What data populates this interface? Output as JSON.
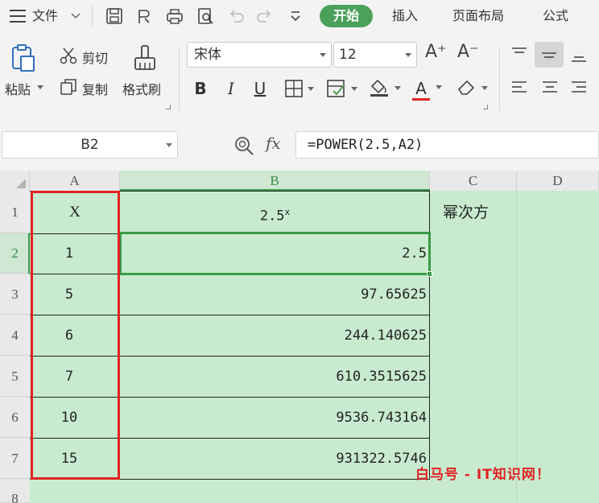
{
  "menu": {
    "file_label": "文件",
    "tabs": [
      {
        "label": "开始",
        "active": true
      },
      {
        "label": "插入"
      },
      {
        "label": "页面布局"
      },
      {
        "label": "公式"
      }
    ]
  },
  "ribbon": {
    "paste_label": "粘贴",
    "cut_label": "剪切",
    "copy_label": "复制",
    "format_painter_label": "格式刷",
    "font_name": "宋体",
    "font_size": "12",
    "bold": "B",
    "italic": "I",
    "underline": "U",
    "font_color_glyph": "A",
    "font_color": "#e02323",
    "grow_font_glyph": "A⁺",
    "shrink_font_glyph": "A⁻"
  },
  "formula_bar": {
    "name_box": "B2",
    "fx_label": "fx",
    "formula": "=POWER(2.5,A2)"
  },
  "sheet": {
    "columns": [
      "A",
      "B",
      "C",
      "D"
    ],
    "rows": [
      "1",
      "2",
      "3",
      "4",
      "5",
      "6",
      "7",
      "8"
    ],
    "selected_cell": "B2",
    "header_row": {
      "a": "X",
      "b_base": "2.5",
      "b_exp": "x",
      "c": "幂次方"
    },
    "data_rows": [
      {
        "a": "1",
        "b": "2.5"
      },
      {
        "a": "5",
        "b": "97.65625"
      },
      {
        "a": "6",
        "b": "244.140625"
      },
      {
        "a": "7",
        "b": "610.3515625"
      },
      {
        "a": "10",
        "b": "9536.743164"
      },
      {
        "a": "15",
        "b": "931322.5746"
      }
    ],
    "fill_color": "#c8ebcf",
    "highlight_border_color": "#e02323",
    "selection_color": "#3a9a4a"
  },
  "watermark": "白马号 - IT知识网！"
}
